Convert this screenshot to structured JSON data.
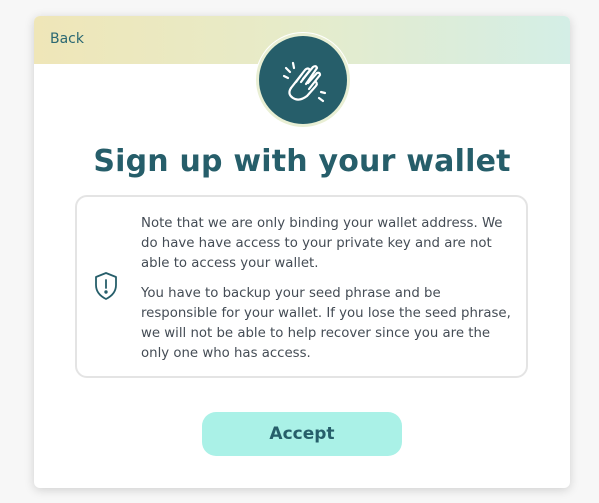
{
  "header": {
    "back_label": "Back"
  },
  "hero": {
    "icon": "clapping-hands-icon"
  },
  "dialog": {
    "title": "Sign up with your wallet",
    "notice_icon": "shield-alert-icon",
    "paragraphs": [
      "Note that we are only binding your wallet address. We do have have access to your private key and are not able to access your wallet.",
      "You have to backup your seed phrase and be responsible for your wallet. If you lose the seed phrase, we will not be able to help recover since you are the only one who has access."
    ],
    "accept_label": "Accept"
  },
  "colors": {
    "primary": "#265e6a",
    "accent": "#aaf1e7",
    "header_gradient_start": "#efe6b8",
    "header_gradient_end": "#d4eee6"
  }
}
